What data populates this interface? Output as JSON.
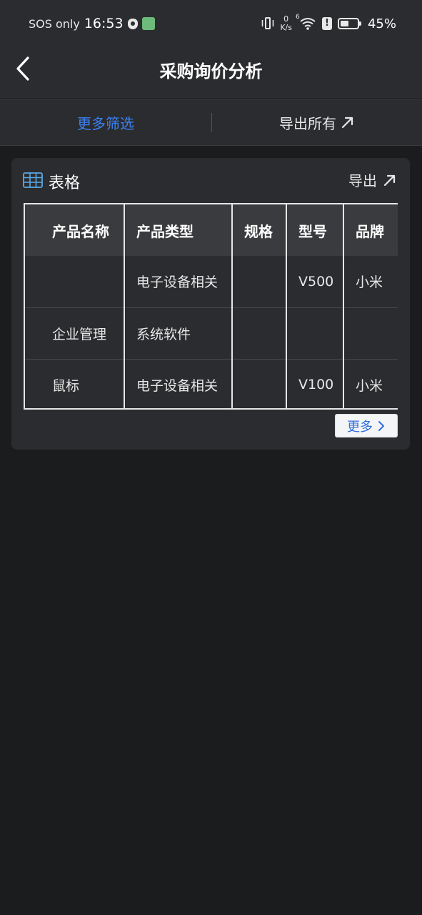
{
  "status_bar": {
    "carrier": "SOS only",
    "time": "16:53",
    "net_speed_value": "0",
    "net_speed_unit": "K/s",
    "wifi_badge": "6",
    "warning_glyph": "!",
    "battery_level": "45%",
    "icons": [
      "shield-icon",
      "app-notification-icon",
      "vibrate-icon",
      "wifi-icon",
      "warning-icon",
      "battery-icon"
    ]
  },
  "nav": {
    "title": "采购询价分析",
    "back_icon": "chevron-left-icon"
  },
  "filter_bar": {
    "more_filters_label": "更多筛选",
    "export_all_label": "导出所有",
    "export_all_icon": "arrow-up-right-icon"
  },
  "card": {
    "title": "表格",
    "title_icon": "table-icon",
    "export_label": "导出",
    "export_icon": "arrow-up-right-icon",
    "more_label": "更多",
    "more_icon": "chevron-right-icon"
  },
  "table": {
    "headers": [
      "产品名称",
      "产品类型",
      "规格",
      "型号",
      "品牌"
    ],
    "rows": [
      [
        "",
        "电子设备相关",
        "",
        "V500",
        "小米"
      ],
      [
        "企业管理",
        "系统软件",
        "",
        "",
        ""
      ],
      [
        "鼠标",
        "电子设备相关",
        "",
        "V100",
        "小米"
      ]
    ]
  },
  "colors": {
    "background": "#1b1c1e",
    "surface": "#2b2c2f",
    "header_cell": "#3a3b3e",
    "accent_blue": "#3b82f6",
    "more_button_text": "#2f6fe0"
  }
}
